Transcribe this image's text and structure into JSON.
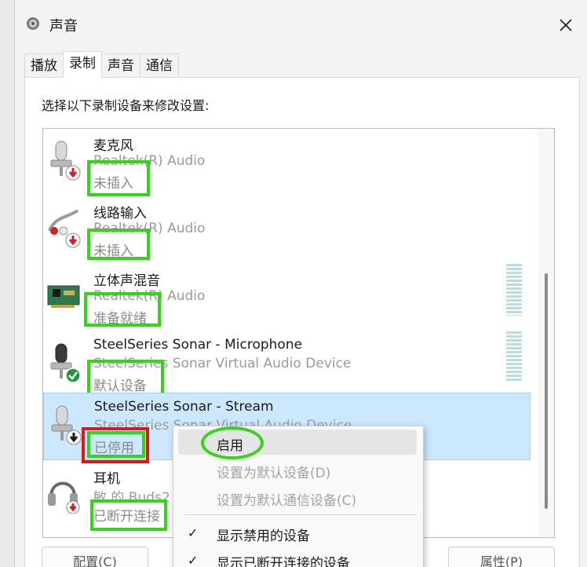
{
  "window": {
    "title": "声音"
  },
  "tabs": [
    {
      "label": "播放",
      "active": false
    },
    {
      "label": "录制",
      "active": true
    },
    {
      "label": "声音",
      "active": false
    },
    {
      "label": "通信",
      "active": false
    }
  ],
  "instruction": "选择以下录制设备来修改设置:",
  "devices": [
    {
      "name": "麦克风",
      "driver": "Realtek(R) Audio",
      "status": "未插入",
      "icon": "microphone-icon",
      "badge": "red-down-arrow"
    },
    {
      "name": "线路输入",
      "driver": "Realtek(R) Audio",
      "status": "未插入",
      "icon": "line-in-cable-icon",
      "badge": "red-down-arrow"
    },
    {
      "name": "立体声混音",
      "driver": "Realtek(R) Audio",
      "status": "准备就绪",
      "icon": "sound-card-icon",
      "badge": "none"
    },
    {
      "name": "SteelSeries Sonar - Microphone",
      "driver": "SteelSeries Sonar Virtual Audio Device",
      "status": "默认设备",
      "icon": "microphone-icon",
      "badge": "green-check"
    },
    {
      "name": "SteelSeries Sonar - Stream",
      "driver": "SteelSeries Sonar Virtual Audio Device",
      "status": "已停用",
      "icon": "microphone-icon",
      "badge": "black-down-arrow"
    },
    {
      "name": "耳机",
      "driver": "敏 的 Buds2",
      "status": "已断开连接",
      "icon": "headset-icon",
      "badge": "red-down-arrow"
    }
  ],
  "context_menu": {
    "items": [
      {
        "label": "启用",
        "enabled": true
      },
      {
        "label": "设置为默认设备(D)",
        "enabled": false
      },
      {
        "label": "设置为默认通信设备(C)",
        "enabled": false
      },
      {
        "label": "显示禁用的设备",
        "checked": true
      },
      {
        "label": "显示已断开连接的设备",
        "checked": true
      }
    ]
  },
  "buttons": {
    "configure": "配置(C)",
    "properties": "属性(P)"
  },
  "colors": {
    "highlight_green": "#36d419",
    "highlight_red": "#d61a1a",
    "selection": "#cce8ff"
  }
}
